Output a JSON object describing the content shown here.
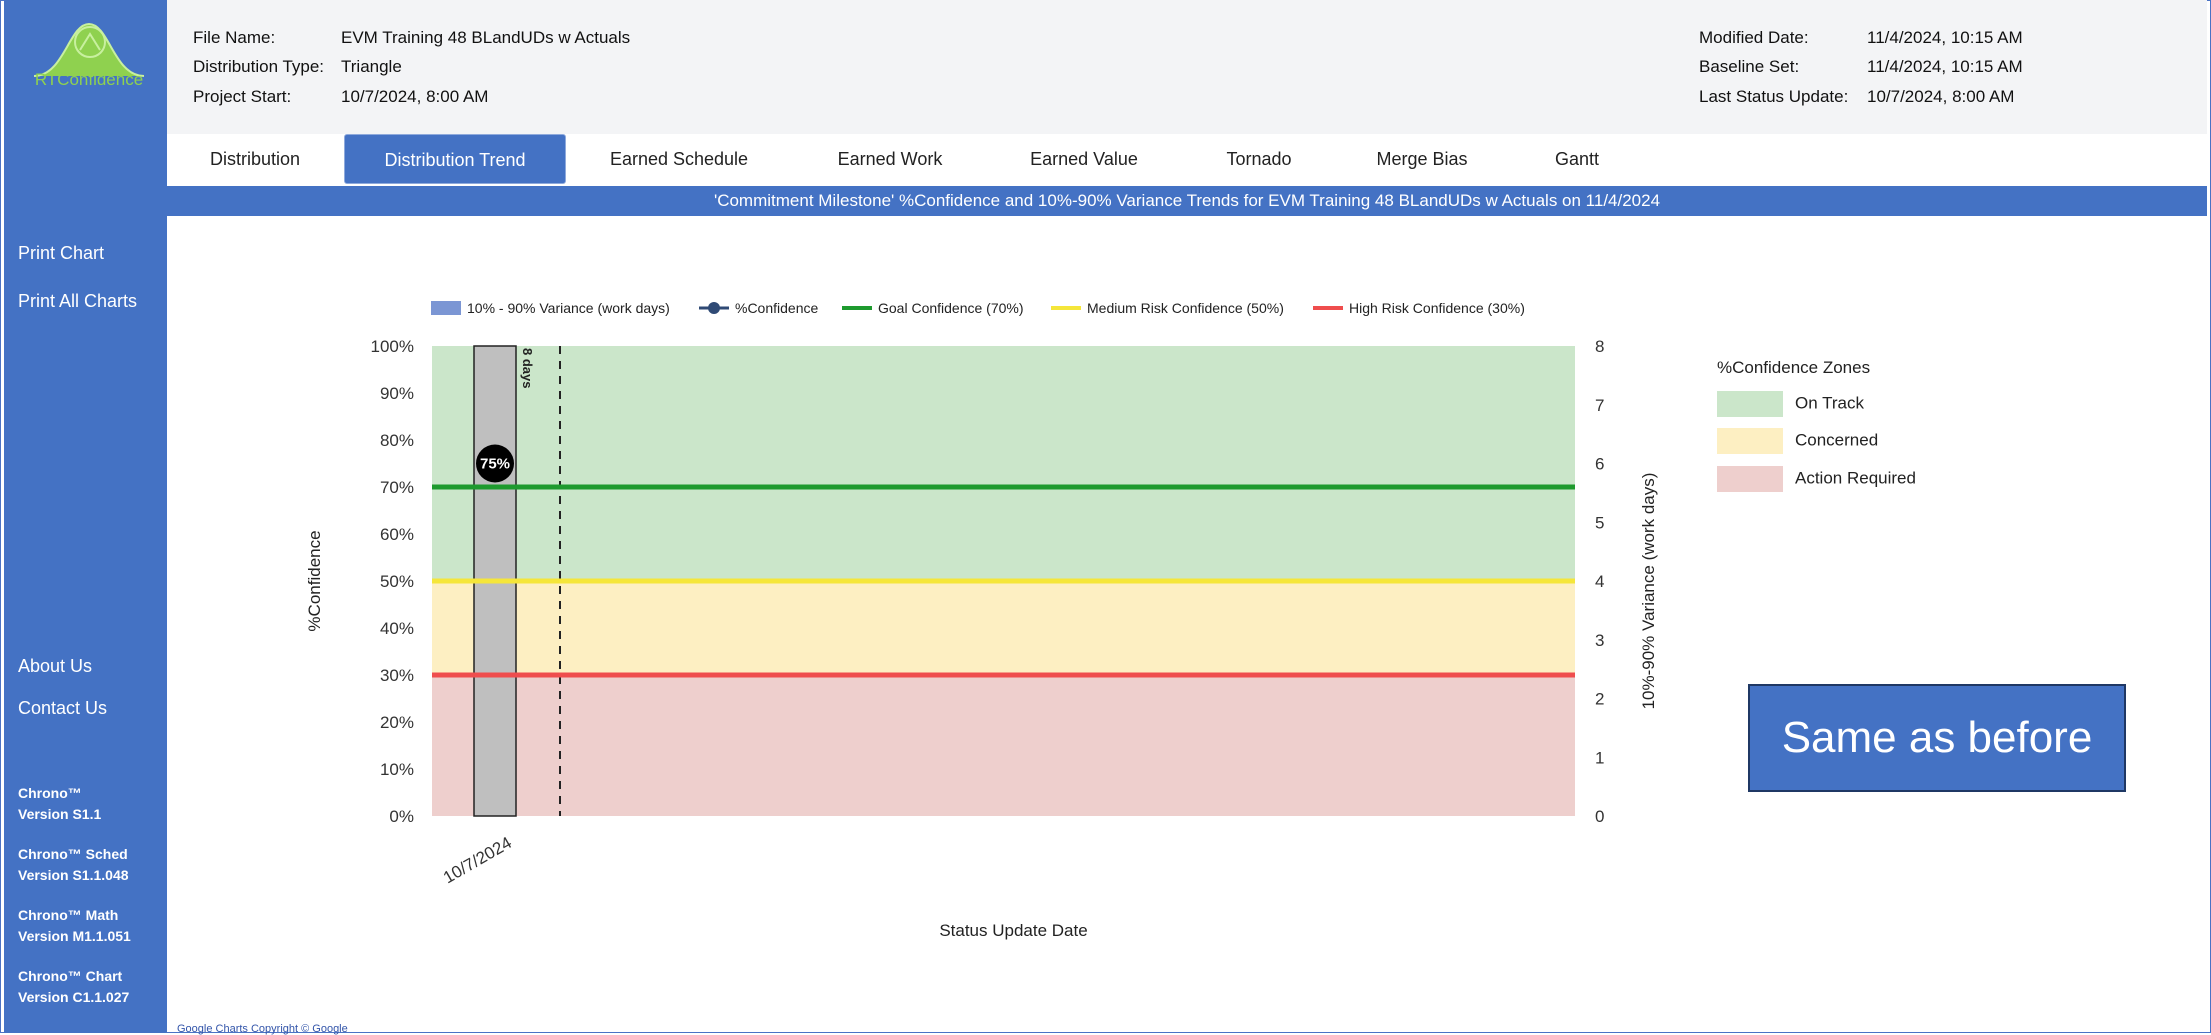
{
  "sidebar": {
    "logo_text": "RTConfidence",
    "links": [
      {
        "label": "Print Chart"
      },
      {
        "label": "Print All Charts"
      },
      {
        "label": "About Us"
      },
      {
        "label": "Contact Us"
      }
    ],
    "versions": [
      {
        "name": "Chrono™",
        "version": "Version S1.1"
      },
      {
        "name": "Chrono™ Sched",
        "version": "Version S1.1.048"
      },
      {
        "name": "Chrono™ Math",
        "version": "Version M1.1.051"
      },
      {
        "name": "Chrono™ Chart",
        "version": "Version C1.1.027"
      }
    ]
  },
  "header": {
    "left": [
      {
        "label": "File Name:",
        "value": "EVM Training 48 BLandUDs w Actuals"
      },
      {
        "label": "Distribution Type:",
        "value": "Triangle"
      },
      {
        "label": "Project Start:",
        "value": "10/7/2024, 8:00 AM"
      }
    ],
    "right": [
      {
        "label": "Modified Date:",
        "value": "11/4/2024, 10:15 AM"
      },
      {
        "label": "Baseline Set:",
        "value": "11/4/2024, 10:15 AM"
      },
      {
        "label": "Last Status Update:",
        "value": "10/7/2024, 8:00 AM"
      }
    ]
  },
  "tabs": [
    {
      "label": "Distribution"
    },
    {
      "label": "Distribution Trend"
    },
    {
      "label": "Earned Schedule"
    },
    {
      "label": "Earned Work"
    },
    {
      "label": "Earned Value"
    },
    {
      "label": "Tornado"
    },
    {
      "label": "Merge Bias"
    },
    {
      "label": "Gantt"
    }
  ],
  "active_tab": "Distribution Trend",
  "banner": "'Commitment Milestone' %Confidence and 10%-90% Variance Trends for EVM Training 48 BLandUDs w Actuals on 11/4/2024",
  "colors": {
    "accent": "#4472c4",
    "on_track": "#cbe6ca",
    "concerned": "#fdefc2",
    "action_required": "#eecfcd",
    "goal_line": "#1e9a2e",
    "medium_line": "#f5e63a",
    "high_line": "#ef4d4d",
    "variance_bar": "#bfbfbf",
    "logo_green": "#8fd14f"
  },
  "zones": {
    "title": "%Confidence Zones",
    "items": [
      {
        "label": "On Track",
        "color": "#cbe6ca"
      },
      {
        "label": "Concerned",
        "color": "#fdefc2"
      },
      {
        "label": "Action Required",
        "color": "#eecfcd"
      }
    ]
  },
  "callout": "Same as before",
  "copyright": "Google Charts Copyright © Google",
  "chart_data": {
    "type": "bar",
    "legend": [
      {
        "label": "10% - 90% Variance (work days)",
        "kind": "bar",
        "color": "#7b96d4"
      },
      {
        "label": "%Confidence",
        "kind": "marker",
        "color": "#2f4a75"
      },
      {
        "label": "Goal Confidence (70%)",
        "kind": "line",
        "color": "#1e9a2e"
      },
      {
        "label": "Medium Risk Confidence (50%)",
        "kind": "line",
        "color": "#f5e63a"
      },
      {
        "label": "High Risk Confidence (30%)",
        "kind": "line",
        "color": "#ef4d4d"
      }
    ],
    "categories": [
      "10/7/2024"
    ],
    "series": [
      {
        "name": "10% - 90% Variance (work days)",
        "axis": "right",
        "values": [
          8
        ]
      },
      {
        "name": "%Confidence",
        "axis": "left",
        "values": [
          75
        ]
      }
    ],
    "bar_label": "8 days",
    "point_label": "75%",
    "reference_lines": [
      {
        "name": "Goal Confidence (70%)",
        "value": 70
      },
      {
        "name": "Medium Risk Confidence (50%)",
        "value": 50
      },
      {
        "name": "High Risk Confidence (30%)",
        "value": 30
      }
    ],
    "xlabel": "Status Update Date",
    "ylabel_left": "%Confidence",
    "ylabel_right": "10%-90% Variance (work days)",
    "ylim_left": [
      0,
      100
    ],
    "ylim_right": [
      0,
      8
    ],
    "left_ticks": [
      "0%",
      "10%",
      "20%",
      "30%",
      "40%",
      "50%",
      "60%",
      "70%",
      "80%",
      "90%",
      "100%"
    ],
    "right_ticks": [
      "0",
      "1",
      "2",
      "3",
      "4",
      "5",
      "6",
      "7",
      "8"
    ],
    "status_date_marker": "dashed"
  }
}
